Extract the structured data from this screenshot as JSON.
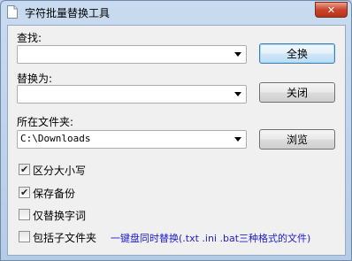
{
  "window": {
    "title": "字符批量替换工具",
    "icon": "document-icon",
    "close_glyph": "✕"
  },
  "form": {
    "find_label": "查找:",
    "find_value": "",
    "replace_label": "替换为:",
    "replace_value": "",
    "folder_label": "所在文件夹:",
    "folder_value": "C:\\Downloads"
  },
  "buttons": {
    "replace_all": "全换",
    "close": "关闭",
    "browse": "浏览"
  },
  "options": [
    {
      "label": "区分大小写",
      "checked": true
    },
    {
      "label": "保存备份",
      "checked": true
    },
    {
      "label": "仅替换字词",
      "checked": false
    },
    {
      "label": "包括子文件夹",
      "checked": false
    }
  ],
  "note": "一键盘同时替换(.txt .ini .bat三种格式的文件)",
  "colors": {
    "note_text": "#1d1dcc",
    "close_button": "#c8452c",
    "default_button_border": "#3c7fb1"
  }
}
